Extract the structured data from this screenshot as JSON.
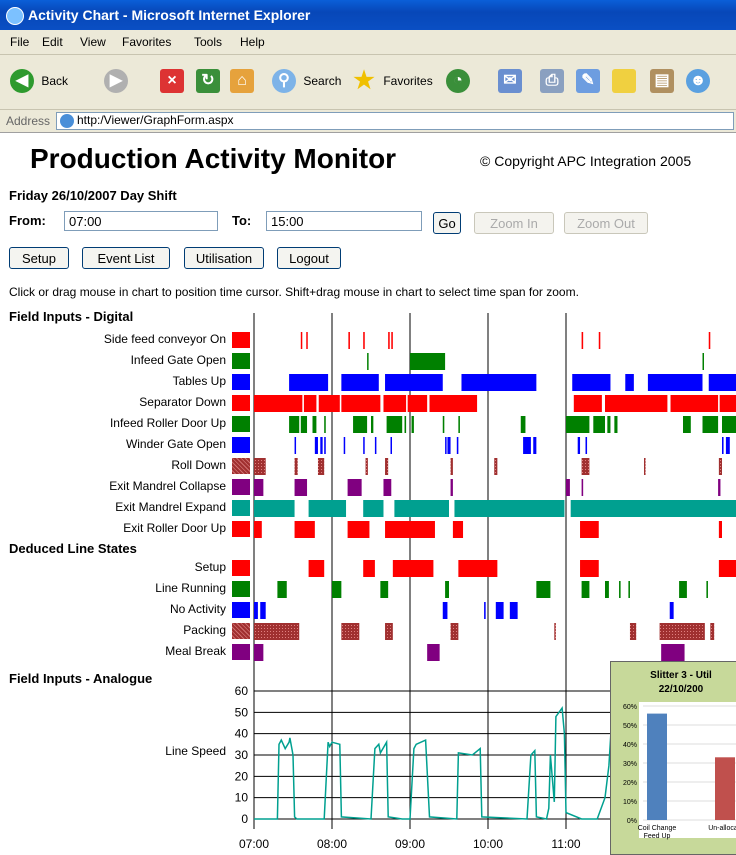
{
  "window": {
    "title": "Activity Chart - Microsoft Internet Explorer"
  },
  "menu": [
    "File",
    "Edit",
    "View",
    "Favorites",
    "Tools",
    "Help"
  ],
  "toolbar": {
    "back": "Back",
    "search": "Search",
    "favorites": "Favorites"
  },
  "address": {
    "label": "Address",
    "url": "http:/Viewer/GraphForm.aspx"
  },
  "page": {
    "title": "Production Activity Monitor",
    "copyright": "© Copyright APC Integration 2005",
    "shift": "Friday 26/10/2007 Day Shift",
    "from_label": "From:",
    "from_value": "07:00",
    "to_label": "To:",
    "to_value": "15:00",
    "go": "Go",
    "zoom_in": "Zoom In",
    "zoom_out": "Zoom Out",
    "buttons": {
      "setup": "Setup",
      "event_list": "Event List",
      "utilisation": "Utilisation",
      "logout": "Logout"
    },
    "instructions": "Click or drag mouse in chart to position time cursor. Shift+drag mouse in chart to select time span for zoom.",
    "section_digital": "Field Inputs - Digital",
    "section_deduced": "Deduced Line States",
    "section_analogue": "Field Inputs - Analogue",
    "analogue_label": "Line Speed"
  },
  "colors": {
    "red": "#ff0000",
    "green": "#008000",
    "blue": "#0000ff",
    "maroon": "#a03030",
    "purple": "#800080",
    "teal": "#00a090"
  },
  "digital_rows": [
    {
      "label": "Side feed conveyor On",
      "color": "red",
      "pattern": "solid"
    },
    {
      "label": "Infeed Gate Open",
      "color": "green",
      "pattern": "solid"
    },
    {
      "label": "Tables Up",
      "color": "blue",
      "pattern": "solid"
    },
    {
      "label": "Separator Down",
      "color": "red",
      "pattern": "solid"
    },
    {
      "label": "Infeed Roller Door Up",
      "color": "green",
      "pattern": "solid"
    },
    {
      "label": "Winder Gate Open",
      "color": "blue",
      "pattern": "solid"
    },
    {
      "label": "Roll Down",
      "color": "maroon",
      "pattern": "hatched"
    },
    {
      "label": "Exit  Mandrel Collapse",
      "color": "purple",
      "pattern": "solid"
    },
    {
      "label": "Exit  Mandrel Expand",
      "color": "teal",
      "pattern": "solid"
    },
    {
      "label": "Exit  Roller Door Up",
      "color": "red",
      "pattern": "solid"
    }
  ],
  "deduced_rows": [
    {
      "label": "Setup",
      "color": "red",
      "pattern": "solid"
    },
    {
      "label": "Line Running",
      "color": "green",
      "pattern": "solid"
    },
    {
      "label": "No Activity",
      "color": "blue",
      "pattern": "solid"
    },
    {
      "label": "Packing",
      "color": "maroon",
      "pattern": "hatched"
    },
    {
      "label": "Meal Break",
      "color": "purple",
      "pattern": "solid"
    }
  ],
  "chart_data": {
    "type": "timeline",
    "x_ticks": [
      "07:00",
      "08:00",
      "09:00",
      "10:00",
      "11:00"
    ],
    "x_start_hour": 7.0,
    "x_end_hour": 13.3,
    "events": [
      {
        "row": "Side feed conveyor On",
        "spans": [
          [
            7.6,
            7.61
          ],
          [
            7.67,
            7.68
          ],
          [
            8.21,
            8.23
          ],
          [
            8.4,
            8.42
          ],
          [
            8.72,
            8.74
          ],
          [
            8.76,
            8.78
          ],
          [
            11.2,
            11.22
          ],
          [
            11.42,
            11.44
          ],
          [
            12.83,
            12.85
          ]
        ]
      },
      {
        "row": "Infeed Gate Open",
        "spans": [
          [
            8.45,
            8.46
          ],
          [
            9.0,
            9.45
          ],
          [
            12.75,
            12.76
          ]
        ]
      },
      {
        "row": "Tables Up",
        "spans": [
          [
            7.45,
            7.95
          ],
          [
            8.12,
            8.6
          ],
          [
            8.68,
            9.42
          ],
          [
            9.66,
            10.62
          ],
          [
            11.08,
            11.57
          ],
          [
            11.76,
            11.87
          ],
          [
            12.05,
            12.75
          ],
          [
            12.83,
            13.3
          ]
        ]
      },
      {
        "row": "Separator Down",
        "spans": [
          [
            7.0,
            7.62
          ],
          [
            7.64,
            7.8
          ],
          [
            7.83,
            8.1
          ],
          [
            8.12,
            8.62
          ],
          [
            8.66,
            8.95
          ],
          [
            8.97,
            9.22
          ],
          [
            9.25,
            9.86
          ],
          [
            11.1,
            11.46
          ],
          [
            11.5,
            12.3
          ],
          [
            12.34,
            12.95
          ],
          [
            12.97,
            13.3
          ]
        ]
      },
      {
        "row": "Infeed Roller Door Up",
        "spans": [
          [
            7.45,
            7.58
          ],
          [
            7.6,
            7.68
          ],
          [
            7.75,
            7.8
          ],
          [
            7.9,
            7.92
          ],
          [
            8.27,
            8.45
          ],
          [
            8.5,
            8.53
          ],
          [
            8.7,
            8.9
          ],
          [
            8.93,
            8.95
          ],
          [
            9.02,
            9.05
          ],
          [
            9.42,
            9.44
          ],
          [
            9.62,
            9.64
          ],
          [
            10.42,
            10.48
          ],
          [
            11.0,
            11.3
          ],
          [
            11.35,
            11.5
          ],
          [
            11.53,
            11.57
          ],
          [
            11.62,
            11.66
          ],
          [
            12.5,
            12.6
          ],
          [
            12.75,
            12.95
          ],
          [
            13.0,
            13.3
          ]
        ]
      },
      {
        "row": "Winder Gate Open",
        "spans": [
          [
            7.52,
            7.53
          ],
          [
            7.78,
            7.82
          ],
          [
            7.85,
            7.88
          ],
          [
            7.9,
            7.92
          ],
          [
            8.15,
            8.16
          ],
          [
            8.4,
            8.41
          ],
          [
            8.55,
            8.56
          ],
          [
            8.75,
            8.76
          ],
          [
            9.45,
            9.46
          ],
          [
            9.48,
            9.52
          ],
          [
            9.6,
            9.62
          ],
          [
            10.45,
            10.55
          ],
          [
            10.58,
            10.62
          ],
          [
            11.15,
            11.18
          ],
          [
            11.25,
            11.27
          ],
          [
            13.0,
            13.02
          ],
          [
            13.05,
            13.1
          ]
        ]
      },
      {
        "row": "Roll Down",
        "spans": [
          [
            7.0,
            7.15
          ],
          [
            7.52,
            7.56
          ],
          [
            7.82,
            7.9
          ],
          [
            8.43,
            8.46
          ],
          [
            8.68,
            8.72
          ],
          [
            9.52,
            9.55
          ],
          [
            10.08,
            10.12
          ],
          [
            11.2,
            11.3
          ],
          [
            12.0,
            12.02
          ],
          [
            12.96,
            13.0
          ]
        ]
      },
      {
        "row": "Exit  Mandrel Collapse",
        "spans": [
          [
            7.0,
            7.12
          ],
          [
            7.52,
            7.68
          ],
          [
            8.2,
            8.38
          ],
          [
            8.66,
            8.76
          ],
          [
            9.52,
            9.55
          ],
          [
            11.0,
            11.05
          ],
          [
            11.2,
            11.22
          ],
          [
            12.95,
            12.98
          ]
        ]
      },
      {
        "row": "Exit  Mandrel Expand",
        "spans": [
          [
            7.0,
            7.52
          ],
          [
            7.7,
            8.18
          ],
          [
            8.4,
            8.66
          ],
          [
            8.8,
            9.5
          ],
          [
            9.57,
            10.98
          ],
          [
            11.06,
            13.3
          ]
        ]
      },
      {
        "row": "Exit  Roller Door Up",
        "spans": [
          [
            7.0,
            7.1
          ],
          [
            7.52,
            7.78
          ],
          [
            8.2,
            8.48
          ],
          [
            8.68,
            9.32
          ],
          [
            9.55,
            9.68
          ],
          [
            11.18,
            11.42
          ],
          [
            12.96,
            13.0
          ]
        ]
      },
      {
        "row": "Setup",
        "spans": [
          [
            7.7,
            7.9
          ],
          [
            8.4,
            8.55
          ],
          [
            8.78,
            9.3
          ],
          [
            9.62,
            10.12
          ],
          [
            11.18,
            11.42
          ],
          [
            12.96,
            13.3
          ]
        ]
      },
      {
        "row": "Line Running",
        "spans": [
          [
            7.3,
            7.42
          ],
          [
            8.0,
            8.12
          ],
          [
            8.62,
            8.72
          ],
          [
            9.45,
            9.5
          ],
          [
            10.62,
            10.8
          ],
          [
            11.2,
            11.3
          ],
          [
            11.5,
            11.55
          ],
          [
            11.68,
            11.7
          ],
          [
            11.8,
            11.82
          ],
          [
            12.45,
            12.55
          ],
          [
            12.8,
            12.82
          ]
        ]
      },
      {
        "row": "No Activity",
        "spans": [
          [
            7.0,
            7.05
          ],
          [
            7.08,
            7.15
          ],
          [
            9.42,
            9.48
          ],
          [
            9.95,
            9.97
          ],
          [
            10.1,
            10.2
          ],
          [
            10.28,
            10.38
          ],
          [
            12.33,
            12.38
          ]
        ]
      },
      {
        "row": "Packing",
        "spans": [
          [
            7.0,
            7.58
          ],
          [
            8.12,
            8.35
          ],
          [
            8.68,
            8.78
          ],
          [
            9.52,
            9.62
          ],
          [
            10.85,
            10.87
          ],
          [
            11.82,
            11.9
          ],
          [
            12.2,
            12.78
          ],
          [
            12.85,
            12.9
          ]
        ]
      },
      {
        "row": "Meal Break",
        "spans": [
          [
            7.0,
            7.12
          ],
          [
            9.22,
            9.38
          ],
          [
            12.22,
            12.52
          ]
        ]
      }
    ],
    "analogue": {
      "ylabel": "Line Speed",
      "y_ticks": [
        0,
        10,
        20,
        30,
        40,
        50,
        60
      ],
      "ylim": [
        0,
        60
      ],
      "series": [
        {
          "x": [
            7.0,
            7.3,
            7.32,
            7.35,
            7.4,
            7.45,
            7.46,
            7.5,
            7.52,
            7.55,
            7.9,
            7.95,
            7.97,
            8.0,
            8.1,
            8.12,
            8.5,
            8.55,
            8.6,
            8.62,
            8.7,
            8.72,
            8.9,
            9.0,
            9.05,
            9.08,
            9.2,
            9.25,
            9.6,
            9.62,
            9.8,
            9.9,
            9.92,
            10.5,
            10.55,
            10.6,
            10.62,
            10.75,
            10.78,
            10.8,
            10.85,
            10.87,
            10.95,
            10.98,
            11.0,
            11.2,
            11.4,
            11.5,
            11.55,
            11.6,
            11.8,
            12.4,
            12.5,
            12.6,
            13.3
          ],
          "y": [
            0,
            0,
            35,
            37,
            33,
            36,
            38,
            30,
            1,
            0,
            0,
            36,
            34,
            36,
            35,
            1,
            0,
            33,
            35,
            31,
            36,
            1,
            0,
            0,
            33,
            35,
            37,
            1,
            0,
            31,
            30,
            33,
            1,
            0,
            30,
            32,
            1,
            0,
            5,
            30,
            8,
            48,
            52,
            40,
            3,
            0,
            0,
            10,
            25,
            55,
            30,
            10,
            35,
            20,
            15
          ]
        }
      ]
    },
    "inset": {
      "title": "Slitter 3 - Util",
      "subtitle": "22/10/200",
      "y_ticks": [
        "60%",
        "50%",
        "40%",
        "30%",
        "20%",
        "10%",
        "0%"
      ],
      "categories": [
        "Coil Change Feed Up",
        "Un-alloca"
      ],
      "values": [
        0.56,
        0.33
      ],
      "colors": [
        "#4f81bd",
        "#c0504d"
      ]
    }
  }
}
